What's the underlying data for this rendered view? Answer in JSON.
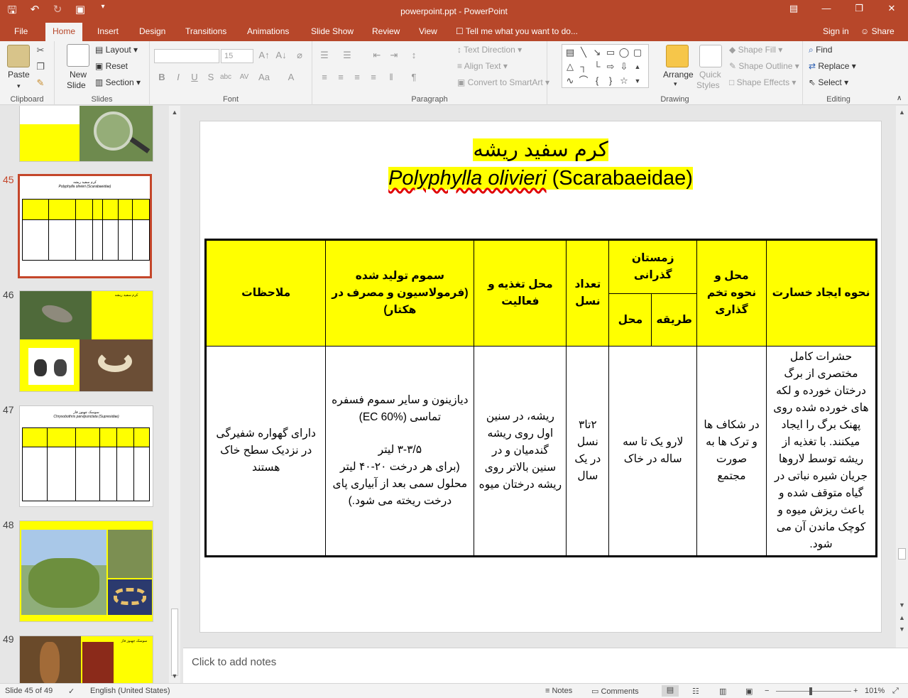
{
  "window": {
    "title": "powerpoint.ppt - PowerPoint",
    "qat": {
      "save": "save-icon",
      "undo": "undo-icon",
      "redo": "redo-icon",
      "present": "present-icon"
    },
    "controls": {
      "options": "ribbon-display-icon",
      "minimize": "minimize-icon",
      "restore": "restore-icon",
      "close": "close-icon"
    }
  },
  "tabs": [
    {
      "label": "File"
    },
    {
      "label": "Home"
    },
    {
      "label": "Insert"
    },
    {
      "label": "Design"
    },
    {
      "label": "Transitions"
    },
    {
      "label": "Animations"
    },
    {
      "label": "Slide Show"
    },
    {
      "label": "Review"
    },
    {
      "label": "View"
    }
  ],
  "tell_me": "Tell me what you want to do...",
  "sign_in": "Sign in",
  "share": "Share",
  "ribbon": {
    "clipboard": {
      "label": "Clipboard",
      "paste": "Paste"
    },
    "slides": {
      "label": "Slides",
      "new_slide": "New",
      "new_slide2": "Slide",
      "layout": "Layout",
      "reset": "Reset",
      "section": "Section"
    },
    "font": {
      "label": "Font",
      "size": "15"
    },
    "paragraph": {
      "label": "Paragraph",
      "text_direction": "Text Direction",
      "align_text": "Align Text",
      "smartart": "Convert to SmartArt"
    },
    "drawing": {
      "label": "Drawing",
      "arrange": "Arrange",
      "quick_styles": "Quick",
      "quick_styles2": "Styles",
      "shape_fill": "Shape Fill",
      "shape_outline": "Shape Outline",
      "shape_effects": "Shape Effects"
    },
    "editing": {
      "label": "Editing",
      "find": "Find",
      "replace": "Replace",
      "select": "Select"
    }
  },
  "thumbnails": [
    {
      "num": "45",
      "title": "کرم سفید ریشه",
      "subtitle": "Polyphylla olivieri (Scarabaeidae)"
    },
    {
      "num": "46",
      "title": "کرم سفید ریشه"
    },
    {
      "num": "47",
      "title": "سوسک چهنوز فاز",
      "subtitle": "Chrysobothris parvipunctata (Supresidae)"
    },
    {
      "num": "48"
    },
    {
      "num": "49",
      "title": "سوسک چهنوز فاز"
    }
  ],
  "slide": {
    "title_fa": "کرم سفید ریشه",
    "title_latin_italic": "Polyphylla olivieri",
    "title_latin_family": "(Scarabaeidae)",
    "headers": {
      "damage": "نحوه ایجاد خسارت",
      "oviposition": "محل و نحوه تخم گذاری",
      "overwintering": "زمستان گذرانی",
      "ow_method": "طریقه",
      "ow_place": "محل",
      "generations": "تعداد نسل",
      "feeding": "محل تغذیه و فعالیت",
      "pesticides": "سموم تولید شده (فرمولاسیون و مصرف در هکتار)",
      "notes": "ملاحظات"
    },
    "row": {
      "damage": "حشرات کامل مختصری از برگ درختان خورده و لکه های خورده شده روی پهنک برگ را ایجاد میکنند. با تغذیه از ریشه توسط لاروها جریان شیره نباتی در گیاه متوقف شده و باعث ریزش میوه و کوچک ماندن آن می شود.",
      "oviposition": "در شکاف ها و ترک ها به صورت مجتمع",
      "overwintering": "لارو یک تا سه ساله در خاک",
      "generations": "۲تا۳ نسل در یک سال",
      "feeding": "ریشه، در سنین اول روی ریشه گندمیان و در سنین بالاتر روی ریشه درختان میوه",
      "pesticides_1": "دیازینون و سایر سموم فسفره تماسی (EC 60%)",
      "pesticides_2": "۳-۳/۵ لیتر",
      "pesticides_3": "(برای هر درخت ۲۰-۴۰ لیتر محلول سمی بعد از آبیاری پای درخت ریخته می شود.)",
      "notes": "دارای گهواره شفیرگی در نزدیک سطح خاک هستند"
    }
  },
  "notes_placeholder": "Click to add notes",
  "status": {
    "slide_of": "Slide 45 of 49",
    "language": "English (United States)",
    "notes": "Notes",
    "comments": "Comments",
    "zoom": "101%"
  },
  "colors": {
    "accent": "#b7472a",
    "highlight": "#ffff00",
    "active_thumb": "#c4462a"
  }
}
